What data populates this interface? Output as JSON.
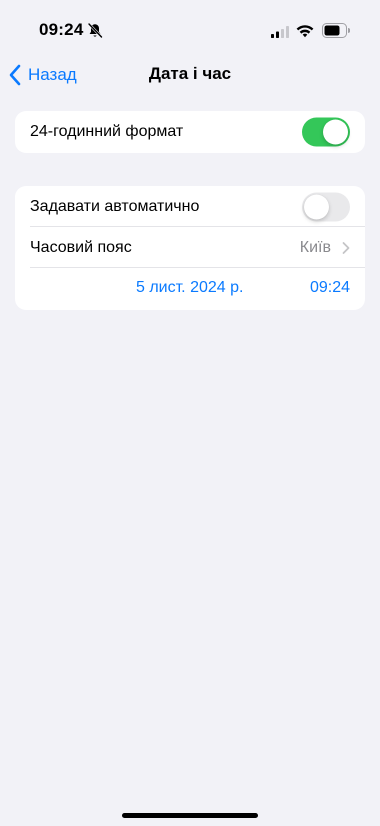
{
  "status_bar": {
    "time": "09:24",
    "icons": [
      "bell-slash-icon",
      "cellular-signal-icon",
      "wifi-icon",
      "battery-icon"
    ]
  },
  "nav": {
    "back_label": "Назад",
    "title": "Дата і час"
  },
  "group1": {
    "label_24h": "24-годинний формат",
    "toggle_24h_on": true
  },
  "group2": {
    "auto_label": "Задавати автоматично",
    "auto_on": false,
    "timezone_label": "Часовий пояс",
    "timezone_value": "Київ",
    "date": "5 лист. 2024 р.",
    "time": "09:24"
  },
  "colors": {
    "accent": "#0a7aff",
    "toggle_on": "#34c759",
    "toggle_off": "#e9e9eb",
    "background": "#f2f2f7",
    "secondary_text": "#8a8a8e"
  }
}
